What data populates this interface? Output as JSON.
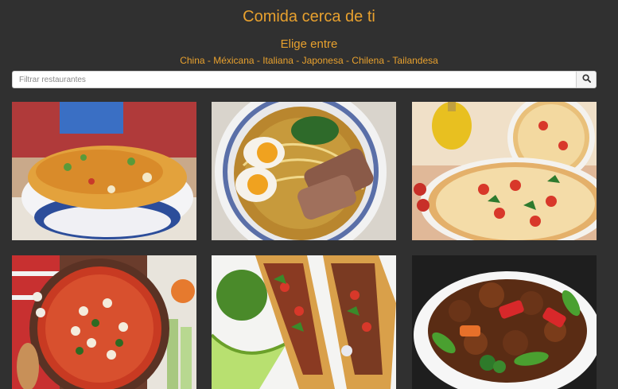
{
  "header": {
    "title": "Comida cerca de ti",
    "subtitle": "Elige entre",
    "cuisines": "China - Méxicana - Italiana - Japonesa - Chilena - Tailandesa"
  },
  "search": {
    "placeholder": "Filtrar restaurantes",
    "button_icon": "search-icon"
  },
  "colors": {
    "background": "#303030",
    "accent": "#e8a12e"
  },
  "tiles": [
    {
      "icon": "fried-rice-image"
    },
    {
      "icon": "ramen-image"
    },
    {
      "icon": "pizza-image"
    },
    {
      "icon": "bean-soup-image"
    },
    {
      "icon": "tacos-image"
    },
    {
      "icon": "stir-fry-image"
    }
  ]
}
